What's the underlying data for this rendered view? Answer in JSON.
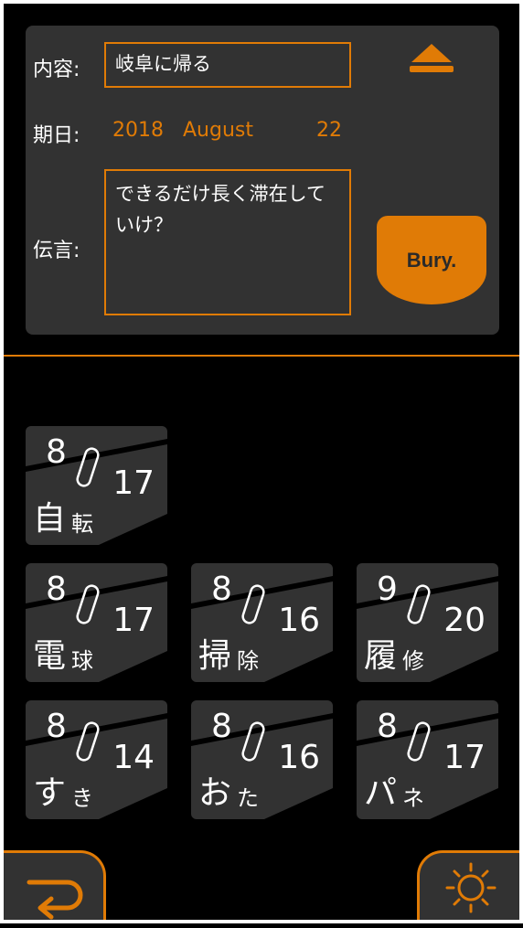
{
  "form": {
    "content_label": "内容:",
    "content_value": "岐阜に帰る",
    "due_label": "期日:",
    "due_year": "2018",
    "due_month": "August",
    "due_day": "22",
    "message_label": "伝言:",
    "message_value": "できるだけ長く滞在していけ？",
    "bury_label": "Bury."
  },
  "cards": [
    {
      "month": "8",
      "day": "17",
      "t1": "自",
      "t2": "転"
    },
    {
      "month": "8",
      "day": "17",
      "t1": "電",
      "t2": "球"
    },
    {
      "month": "8",
      "day": "16",
      "t1": "掃",
      "t2": "除"
    },
    {
      "month": "9",
      "day": "20",
      "t1": "履",
      "t2": "修"
    },
    {
      "month": "8",
      "day": "14",
      "t1": "す",
      "t2": "き"
    },
    {
      "month": "8",
      "day": "16",
      "t1": "お",
      "t2": "た"
    },
    {
      "month": "8",
      "day": "17",
      "t1": "パ",
      "t2": "ネ"
    }
  ],
  "colors": {
    "accent": "#e07b06",
    "panel": "#323232",
    "background": "#000000"
  },
  "icons": {
    "eject": "eject-icon",
    "back": "return-arrow-icon",
    "settings": "sun-icon"
  }
}
